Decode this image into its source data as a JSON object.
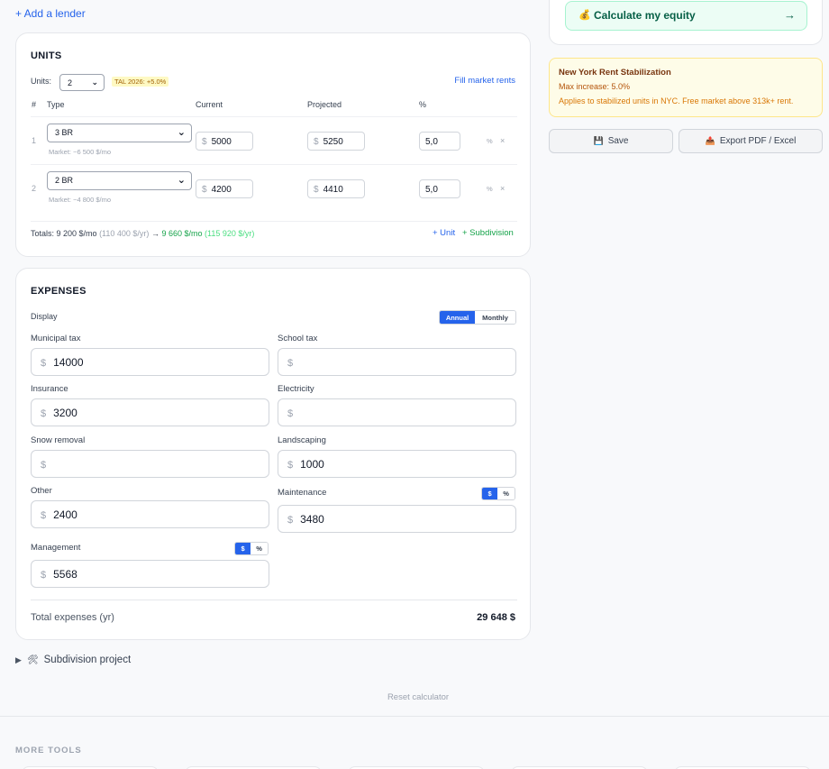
{
  "lenders": {
    "add_label": "+ Add a lender"
  },
  "equity": {
    "icon": "💰",
    "label": "Calculate my equity",
    "arrow": "→"
  },
  "stabilization": {
    "title": "New York Rent Stabilization",
    "max": "Max increase: 5.0%",
    "note": "Applies to stabilized units in NYC. Free market above 313k+ rent."
  },
  "actions": {
    "save_icon": "💾",
    "save": "Save",
    "export_icon": "📤",
    "export": "Export PDF / Excel"
  },
  "units": {
    "title": "UNITS",
    "units_label": "Units:",
    "units_value": "2",
    "tal_badge": "TAL 2026: +5.0%",
    "fill_rents": "Fill market rents",
    "headers": {
      "num": "#",
      "type": "Type",
      "current": "Current",
      "projected": "Projected",
      "pct": "%"
    },
    "rows": [
      {
        "num": "1",
        "type": "3 BR",
        "market": "Market: ~6 500 $/mo",
        "current": "5000",
        "projected": "5250",
        "pct": "5,0",
        "pct_sign": "%",
        "remove": "×"
      },
      {
        "num": "2",
        "type": "2 BR",
        "market": "Market: ~4 800 $/mo",
        "current": "4200",
        "projected": "4410",
        "pct": "5,0",
        "pct_sign": "%",
        "remove": "×"
      }
    ],
    "currency": "$",
    "totals": {
      "prefix": "Totals: 9 200 $/mo",
      "annual": "(110 400 $/yr)",
      "arrow": "→",
      "projected": "9 660 $/mo",
      "projected_annual": "(115 920 $/yr)"
    },
    "add_unit": "+ Unit",
    "add_subdivision": "+ Subdivision"
  },
  "expenses": {
    "title": "EXPENSES",
    "display_label": "Display",
    "display_options": [
      "Annual",
      "Monthly"
    ],
    "currency": "$",
    "toggle_options": [
      "$",
      "%"
    ],
    "fields": {
      "municipal_tax": {
        "label": "Municipal tax",
        "value": "14000"
      },
      "school_tax": {
        "label": "School tax",
        "value": ""
      },
      "insurance": {
        "label": "Insurance",
        "value": "3200"
      },
      "electricity": {
        "label": "Electricity",
        "value": ""
      },
      "snow_removal": {
        "label": "Snow removal",
        "value": ""
      },
      "landscaping": {
        "label": "Landscaping",
        "value": "1000"
      },
      "other": {
        "label": "Other",
        "value": "2400"
      },
      "maintenance": {
        "label": "Maintenance",
        "value": "3480"
      },
      "management": {
        "label": "Management",
        "value": "5568"
      }
    },
    "total_label": "Total expenses (yr)",
    "total_value": "29 648 $"
  },
  "subdivision": {
    "arrow": "▶",
    "icon": "🛠",
    "label": "Subdivision project"
  },
  "reset": "Reset calculator",
  "more_tools": "MORE TOOLS"
}
